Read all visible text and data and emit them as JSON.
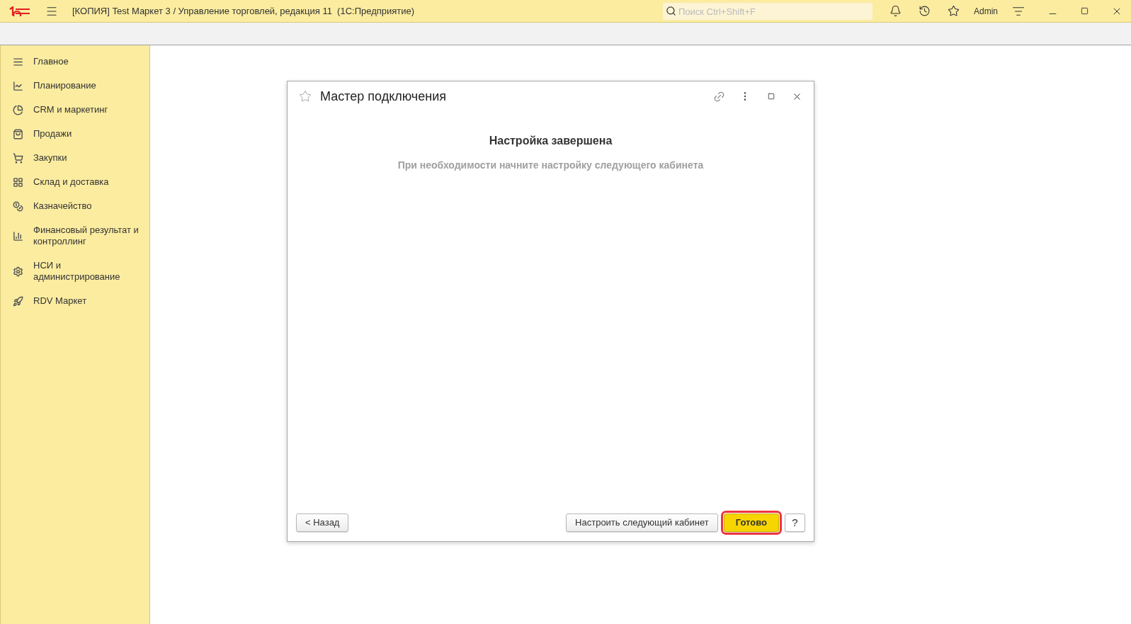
{
  "window": {
    "title": "[КОПИЯ] Test Маркет 3 / Управление торговлей, редакция 11  (1С:Предприятие)",
    "search": {
      "placeholder": "Поиск Ctrl+Shift+F"
    },
    "user": "Admin"
  },
  "sidebar": {
    "items": [
      {
        "label": "Главное"
      },
      {
        "label": "Планирование"
      },
      {
        "label": "CRM и маркетинг"
      },
      {
        "label": "Продажи"
      },
      {
        "label": "Закупки"
      },
      {
        "label": "Склад и доставка"
      },
      {
        "label": "Казначейство"
      },
      {
        "label": "Финансовый результат и контроллинг"
      },
      {
        "label": "НСИ и администрирование"
      },
      {
        "label": "RDV Маркет"
      }
    ]
  },
  "dialog": {
    "title": "Мастер подключения",
    "heading": "Настройка завершена",
    "message": "При необходимости начните настройку следующего кабинета",
    "buttons": [
      {
        "label": "< Назад",
        "kind": "normal",
        "highlighted": false
      },
      {
        "label": "Настроить следующий кабинет",
        "kind": "normal",
        "highlighted": false
      },
      {
        "label": "Готово",
        "kind": "default",
        "highlighted": true
      },
      {
        "label": "?",
        "kind": "help",
        "highlighted": false
      }
    ]
  }
}
